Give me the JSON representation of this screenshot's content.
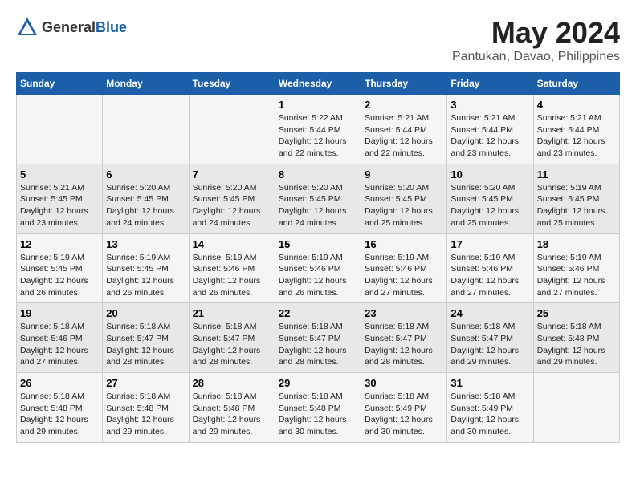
{
  "header": {
    "logo_general": "General",
    "logo_blue": "Blue",
    "title": "May 2024",
    "subtitle": "Pantukan, Davao, Philippines"
  },
  "calendar": {
    "days_of_week": [
      "Sunday",
      "Monday",
      "Tuesday",
      "Wednesday",
      "Thursday",
      "Friday",
      "Saturday"
    ],
    "weeks": [
      [
        {
          "day": "",
          "info": ""
        },
        {
          "day": "",
          "info": ""
        },
        {
          "day": "",
          "info": ""
        },
        {
          "day": "1",
          "info": "Sunrise: 5:22 AM\nSunset: 5:44 PM\nDaylight: 12 hours\nand 22 minutes."
        },
        {
          "day": "2",
          "info": "Sunrise: 5:21 AM\nSunset: 5:44 PM\nDaylight: 12 hours\nand 22 minutes."
        },
        {
          "day": "3",
          "info": "Sunrise: 5:21 AM\nSunset: 5:44 PM\nDaylight: 12 hours\nand 23 minutes."
        },
        {
          "day": "4",
          "info": "Sunrise: 5:21 AM\nSunset: 5:44 PM\nDaylight: 12 hours\nand 23 minutes."
        }
      ],
      [
        {
          "day": "5",
          "info": "Sunrise: 5:21 AM\nSunset: 5:45 PM\nDaylight: 12 hours\nand 23 minutes."
        },
        {
          "day": "6",
          "info": "Sunrise: 5:20 AM\nSunset: 5:45 PM\nDaylight: 12 hours\nand 24 minutes."
        },
        {
          "day": "7",
          "info": "Sunrise: 5:20 AM\nSunset: 5:45 PM\nDaylight: 12 hours\nand 24 minutes."
        },
        {
          "day": "8",
          "info": "Sunrise: 5:20 AM\nSunset: 5:45 PM\nDaylight: 12 hours\nand 24 minutes."
        },
        {
          "day": "9",
          "info": "Sunrise: 5:20 AM\nSunset: 5:45 PM\nDaylight: 12 hours\nand 25 minutes."
        },
        {
          "day": "10",
          "info": "Sunrise: 5:20 AM\nSunset: 5:45 PM\nDaylight: 12 hours\nand 25 minutes."
        },
        {
          "day": "11",
          "info": "Sunrise: 5:19 AM\nSunset: 5:45 PM\nDaylight: 12 hours\nand 25 minutes."
        }
      ],
      [
        {
          "day": "12",
          "info": "Sunrise: 5:19 AM\nSunset: 5:45 PM\nDaylight: 12 hours\nand 26 minutes."
        },
        {
          "day": "13",
          "info": "Sunrise: 5:19 AM\nSunset: 5:45 PM\nDaylight: 12 hours\nand 26 minutes."
        },
        {
          "day": "14",
          "info": "Sunrise: 5:19 AM\nSunset: 5:46 PM\nDaylight: 12 hours\nand 26 minutes."
        },
        {
          "day": "15",
          "info": "Sunrise: 5:19 AM\nSunset: 5:46 PM\nDaylight: 12 hours\nand 26 minutes."
        },
        {
          "day": "16",
          "info": "Sunrise: 5:19 AM\nSunset: 5:46 PM\nDaylight: 12 hours\nand 27 minutes."
        },
        {
          "day": "17",
          "info": "Sunrise: 5:19 AM\nSunset: 5:46 PM\nDaylight: 12 hours\nand 27 minutes."
        },
        {
          "day": "18",
          "info": "Sunrise: 5:19 AM\nSunset: 5:46 PM\nDaylight: 12 hours\nand 27 minutes."
        }
      ],
      [
        {
          "day": "19",
          "info": "Sunrise: 5:18 AM\nSunset: 5:46 PM\nDaylight: 12 hours\nand 27 minutes."
        },
        {
          "day": "20",
          "info": "Sunrise: 5:18 AM\nSunset: 5:47 PM\nDaylight: 12 hours\nand 28 minutes."
        },
        {
          "day": "21",
          "info": "Sunrise: 5:18 AM\nSunset: 5:47 PM\nDaylight: 12 hours\nand 28 minutes."
        },
        {
          "day": "22",
          "info": "Sunrise: 5:18 AM\nSunset: 5:47 PM\nDaylight: 12 hours\nand 28 minutes."
        },
        {
          "day": "23",
          "info": "Sunrise: 5:18 AM\nSunset: 5:47 PM\nDaylight: 12 hours\nand 28 minutes."
        },
        {
          "day": "24",
          "info": "Sunrise: 5:18 AM\nSunset: 5:47 PM\nDaylight: 12 hours\nand 29 minutes."
        },
        {
          "day": "25",
          "info": "Sunrise: 5:18 AM\nSunset: 5:48 PM\nDaylight: 12 hours\nand 29 minutes."
        }
      ],
      [
        {
          "day": "26",
          "info": "Sunrise: 5:18 AM\nSunset: 5:48 PM\nDaylight: 12 hours\nand 29 minutes."
        },
        {
          "day": "27",
          "info": "Sunrise: 5:18 AM\nSunset: 5:48 PM\nDaylight: 12 hours\nand 29 minutes."
        },
        {
          "day": "28",
          "info": "Sunrise: 5:18 AM\nSunset: 5:48 PM\nDaylight: 12 hours\nand 29 minutes."
        },
        {
          "day": "29",
          "info": "Sunrise: 5:18 AM\nSunset: 5:48 PM\nDaylight: 12 hours\nand 30 minutes."
        },
        {
          "day": "30",
          "info": "Sunrise: 5:18 AM\nSunset: 5:49 PM\nDaylight: 12 hours\nand 30 minutes."
        },
        {
          "day": "31",
          "info": "Sunrise: 5:18 AM\nSunset: 5:49 PM\nDaylight: 12 hours\nand 30 minutes."
        },
        {
          "day": "",
          "info": ""
        }
      ]
    ]
  }
}
